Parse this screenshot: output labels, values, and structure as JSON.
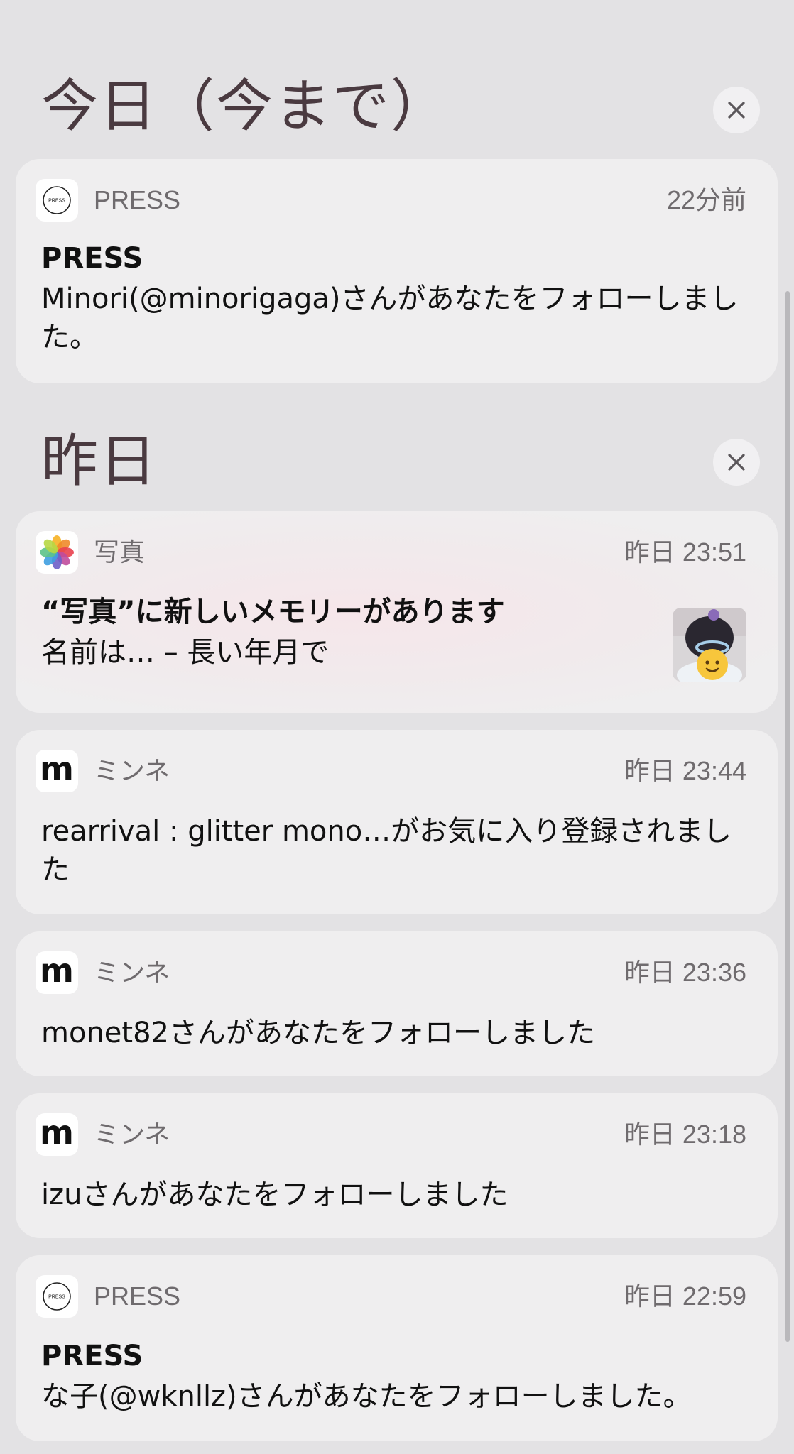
{
  "sections": [
    {
      "title": "今日（今まで）",
      "clear_icon": "close-icon"
    },
    {
      "title": "昨日",
      "clear_icon": "close-icon"
    }
  ],
  "notifications": [
    {
      "app": "PRESS",
      "icon": "press-logo-icon",
      "icon_text": "PRESS",
      "time": "22分前",
      "title": "PRESS",
      "body": "Minori(@minorigaga)さんがあなたをフォローしました。"
    },
    {
      "app": "写真",
      "icon": "photos-icon",
      "time": "昨日 23:51",
      "title": "“写真”に新しいメモリーがあります",
      "body": "名前は… – 長い年月で",
      "thumbnail": "memory-thumbnail"
    },
    {
      "app": "ミンネ",
      "icon": "minne-icon",
      "icon_text": "m",
      "time": "昨日 23:44",
      "body": "rearrival : glitter mono…がお気に入り登録されました"
    },
    {
      "app": "ミンネ",
      "icon": "minne-icon",
      "icon_text": "m",
      "time": "昨日 23:36",
      "body": "monet82さんがあなたをフォローしました"
    },
    {
      "app": "ミンネ",
      "icon": "minne-icon",
      "icon_text": "m",
      "time": "昨日 23:18",
      "body": "izuさんがあなたをフォローしました"
    },
    {
      "app": "PRESS",
      "icon": "press-logo-icon",
      "icon_text": "PRESS",
      "time": "昨日 22:59",
      "title": "PRESS",
      "body": "な子(@wknllz)さんがあなたをフォローしました。"
    }
  ],
  "colors": {
    "background": "#e3e2e4",
    "card": "#efeeef",
    "section_title": "#4a3a40",
    "secondary_text": "#6f6b6e"
  }
}
